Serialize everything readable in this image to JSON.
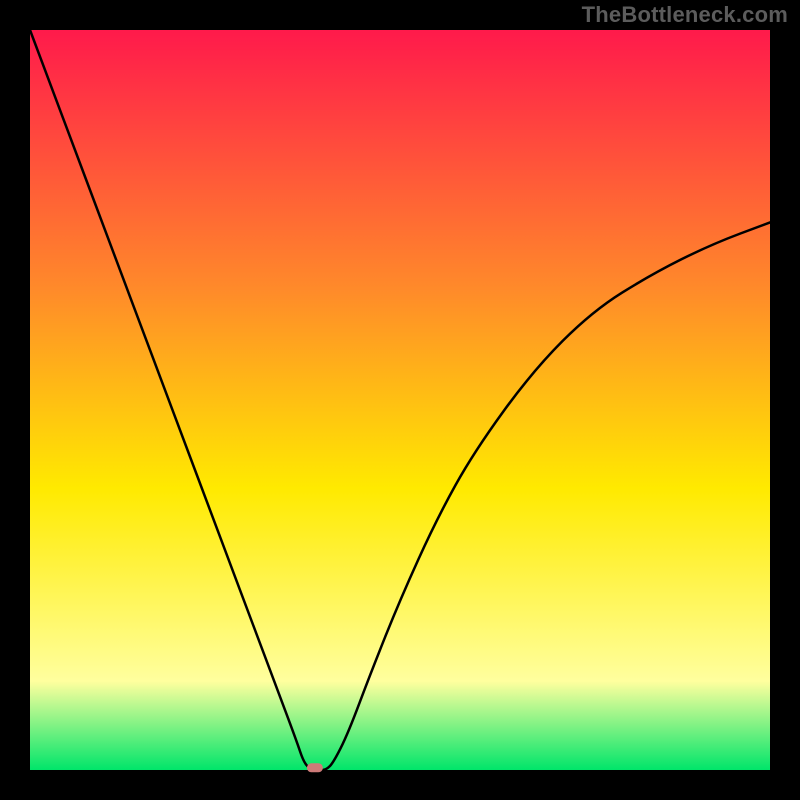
{
  "watermark": "TheBottleneck.com",
  "colors": {
    "border": "#000000",
    "gradient_top": "#ff1a4b",
    "gradient_mid_top": "#ff8a2a",
    "gradient_mid": "#ffea00",
    "gradient_low": "#ffff9e",
    "gradient_bottom": "#00e56a",
    "curve": "#000000",
    "marker": "#cd7a78"
  },
  "chart_data": {
    "type": "line",
    "title": "",
    "xlabel": "",
    "ylabel": "",
    "xlim": [
      0,
      100
    ],
    "ylim": [
      0,
      100
    ],
    "series": [
      {
        "name": "bottleneck-curve",
        "x": [
          0,
          3,
          6,
          9,
          12,
          15,
          18,
          21,
          24,
          27,
          30,
          33,
          36,
          37,
          38,
          39,
          40,
          41,
          43,
          46,
          50,
          55,
          60,
          68,
          76,
          84,
          92,
          100
        ],
        "y": [
          100,
          92,
          84,
          76,
          68,
          60,
          52,
          44,
          36,
          28,
          20,
          12,
          4,
          1,
          0,
          0,
          0,
          1,
          5,
          13,
          23,
          34,
          43,
          54,
          62,
          67,
          71,
          74
        ]
      }
    ],
    "marker": {
      "x": 38.5,
      "y": 0.3
    },
    "legend": false,
    "grid": false
  }
}
